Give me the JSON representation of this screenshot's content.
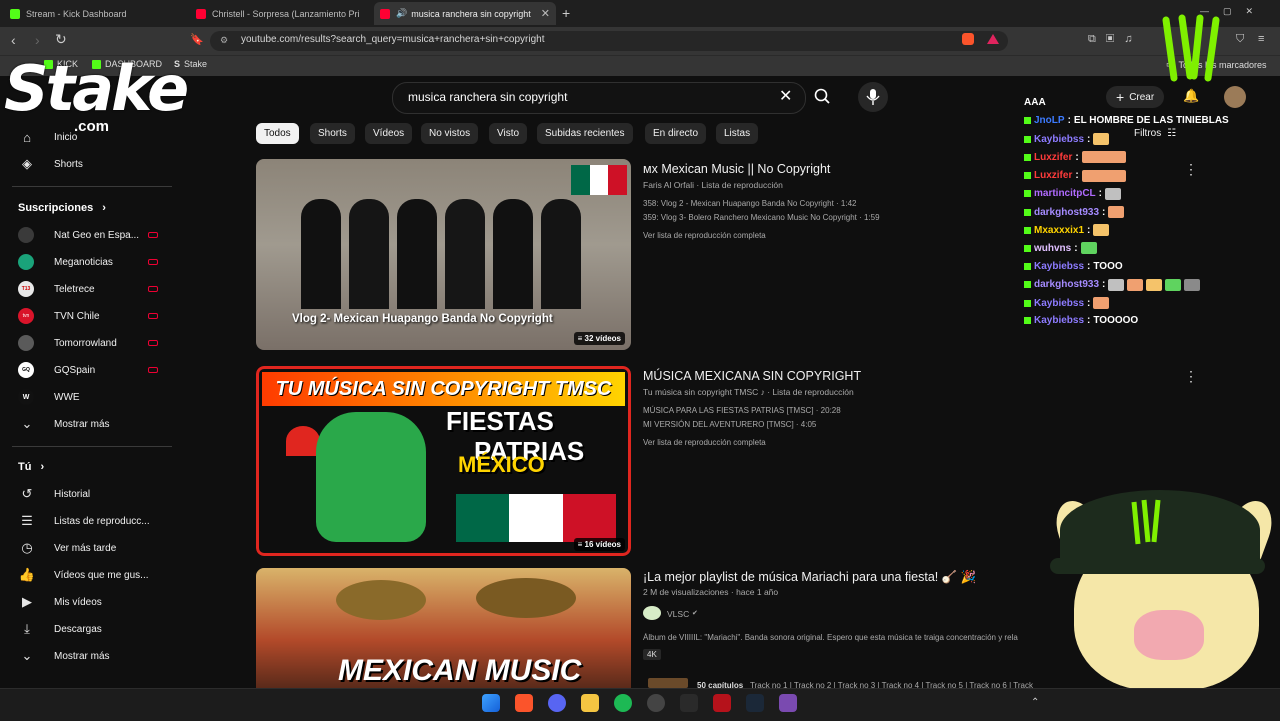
{
  "browser": {
    "tabs": [
      {
        "title": "Stream - Kick Dashboard",
        "active": false
      },
      {
        "title": "Christell - Sorpresa (Lanzamiento Pri",
        "active": false
      },
      {
        "title": "musica ranchera sin copyright",
        "active": true
      }
    ],
    "url": "youtube.com/results?search_query=musica+ranchera+sin+copyright",
    "bookmarks": [
      "KICK",
      "DASHBOARD",
      "Stake"
    ],
    "bookmarks_right": "Todos los marcadores"
  },
  "overlay": {
    "stake_logo": "Stake",
    "stake_sub": ".com"
  },
  "youtube": {
    "search_query": "musica ranchera sin copyright",
    "create_label": "Crear",
    "filters_label": "Filtros",
    "chips": [
      "Todos",
      "Shorts",
      "Vídeos",
      "No vistos",
      "Visto",
      "Subidas recientes",
      "En directo",
      "Listas"
    ],
    "sidebar": {
      "main": [
        {
          "label": "Inicio",
          "icon": "home-icon"
        },
        {
          "label": "Shorts",
          "icon": "shorts-icon"
        }
      ],
      "subscriptions_heading": "Suscripciones",
      "subscriptions": [
        {
          "label": "Nat Geo en Espa...",
          "color": "#3a3a3a",
          "mark": ""
        },
        {
          "label": "Meganoticias",
          "color": "#1aa37a",
          "mark": ""
        },
        {
          "label": "Teletrece",
          "color": "#e9e9e9",
          "mark": "T13"
        },
        {
          "label": "TVN Chile",
          "color": "#d9142a",
          "mark": "tvn"
        },
        {
          "label": "Tomorrowland",
          "color": "#5a5a5a",
          "mark": ""
        },
        {
          "label": "GQSpain",
          "color": "#ffffff",
          "mark": "GQ"
        },
        {
          "label": "WWE",
          "color": "#111111",
          "mark": "W"
        }
      ],
      "show_more_1": "Mostrar más",
      "you_heading": "Tú",
      "you_items": [
        {
          "label": "Historial",
          "icon": "history-icon"
        },
        {
          "label": "Listas de reproducc...",
          "icon": "playlists-icon"
        },
        {
          "label": "Ver más tarde",
          "icon": "watch-later-icon"
        },
        {
          "label": "Vídeos que me gus...",
          "icon": "like-icon"
        },
        {
          "label": "Mis vídeos",
          "icon": "my-videos-icon"
        },
        {
          "label": "Descargas",
          "icon": "download-icon"
        }
      ],
      "show_more_2": "Mostrar más"
    },
    "results": [
      {
        "title": "ᴍx Mexican Music || No Copyright",
        "meta": "Faris Al Orfali · Lista de reproducción",
        "lines": [
          "358: Vlog 2 - Mexican Huapango Banda No Copyright · 1:42",
          "359: Vlog 3- Bolero Ranchero Mexicano Music No Copyright · 1:59"
        ],
        "link": "Ver lista de reproducción completa",
        "thumb_caption": "Vlog 2- Mexican Huapango Banda No Copyright",
        "badge": "32 vídeos"
      },
      {
        "title": "MÚSICA MEXICANA SIN COPYRIGHT",
        "meta": "Tu música sin copyright TMSC ♪ · Lista de reproducción",
        "lines": [
          "MÚSICA PARA LAS FIESTAS PATRIAS [TMSC] · 20:28",
          "MI VERSIÓN DEL AVENTURERO [TMSC] · 4:05"
        ],
        "link": "Ver lista de reproducción completa",
        "thumb_top": "TU MÚSICA SIN COPYRIGHT TMSC",
        "thumb_line1": "FIESTAS",
        "thumb_line2": "PATRIAS",
        "thumb_line3": "MÉXICO",
        "badge": "16 vídeos"
      },
      {
        "title": "¡La mejor playlist de música Mariachi para una fiesta! 🪕 🎉",
        "meta": "2 M de visualizaciones · hace 1 año",
        "channel": "VLSC",
        "desc": "Álbum de VIIIIIL: \"Mariachi\". Banda sonora original. Espero que esta música te traiga concentración y rela",
        "quality": "4K",
        "chapters": "50 capítulos",
        "tracks": "Track no 1 | Track no 2 | Track no 3 | Track no 4 | Track no 5 | Track no 6 | Track",
        "thumb_caption": "MEXICAN MUSIC"
      }
    ]
  },
  "chat": {
    "header": "AAA",
    "lines": [
      {
        "user": "JnoLP",
        "color": "#3d7bff",
        "msg": "EL HOMBRE DE LAS TINIEBLAS",
        "emotes": 0
      },
      {
        "user": "Kaybiebss",
        "color": "#8d7bff",
        "msg": "",
        "emotes": 1
      },
      {
        "user": "Luxzifer",
        "color": "#ff3b3b",
        "msg": "",
        "emotes": 1
      },
      {
        "user": "Luxzifer",
        "color": "#ff3b3b",
        "msg": "",
        "emotes": 1
      },
      {
        "user": "martincitpCL",
        "color": "#b06bff",
        "msg": "",
        "emotes": 1
      },
      {
        "user": "darkghost933",
        "color": "#a58bff",
        "msg": "",
        "emotes": 1
      },
      {
        "user": "Mxaxxxix1",
        "color": "#ffd400",
        "msg": "",
        "emotes": 1
      },
      {
        "user": "wuhvns",
        "color": "#e0c0ff",
        "msg": "",
        "emotes": 1
      },
      {
        "user": "Kaybiebss",
        "color": "#8d7bff",
        "msg": "TOOO",
        "emotes": 0
      },
      {
        "user": "darkghost933",
        "color": "#a58bff",
        "msg": "",
        "emotes": 5
      },
      {
        "user": "Kaybiebss",
        "color": "#8d7bff",
        "msg": "",
        "emotes": 1
      },
      {
        "user": "Kaybiebss",
        "color": "#8d7bff",
        "msg": "TOOOOO",
        "emotes": 0
      }
    ]
  },
  "colors": {
    "kick_green": "#53fc18",
    "youtube_red": "#ff0033",
    "bg": "#0f0f0f"
  }
}
